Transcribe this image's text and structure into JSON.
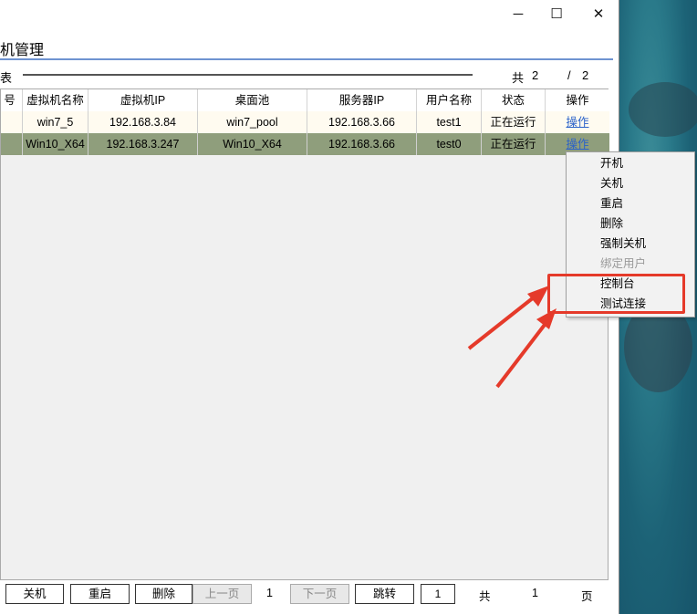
{
  "window": {
    "title_controls": {
      "minimize": "─",
      "maximize": "☐",
      "close": "✕"
    },
    "app_title": "机管理",
    "section_label": "表",
    "page_info": {
      "total_label": "共",
      "total": "2",
      "sep": "/",
      "pages": "2"
    }
  },
  "table": {
    "headers": [
      "号",
      "虚拟机名称",
      "虚拟机IP",
      "桌面池",
      "服务器IP",
      "用户名称",
      "状态",
      "操作"
    ],
    "rows": [
      {
        "name": "win7_5",
        "ip": "192.168.3.84",
        "pool": "win7_pool",
        "server": "192.168.3.66",
        "user": "test1",
        "status": "正在运行",
        "action": "操作"
      },
      {
        "name": "Win10_X64",
        "ip": "192.168.3.247",
        "pool": "Win10_X64",
        "server": "192.168.3.66",
        "user": "test0",
        "status": "正在运行",
        "action": "操作"
      }
    ]
  },
  "context_menu": {
    "items": [
      {
        "label": "开机",
        "enabled": true
      },
      {
        "label": "关机",
        "enabled": true
      },
      {
        "label": "重启",
        "enabled": true
      },
      {
        "label": "删除",
        "enabled": true
      },
      {
        "label": "强制关机",
        "enabled": true
      },
      {
        "label": "绑定用户",
        "enabled": false
      },
      {
        "label": "控制台",
        "enabled": true
      },
      {
        "label": "测试连接",
        "enabled": true
      }
    ]
  },
  "footer": {
    "shutdown": "关机",
    "restart": "重启",
    "delete": "删除",
    "prev": "上一页",
    "current_page": "1",
    "next": "下一页",
    "jump": "跳转",
    "jump_value": "1",
    "total_label": "共",
    "total_pages": "1",
    "page_label": "页"
  },
  "colors": {
    "highlight": "#e53a2a",
    "selected_row": "#8f9e7c",
    "link": "#2b62c9"
  }
}
